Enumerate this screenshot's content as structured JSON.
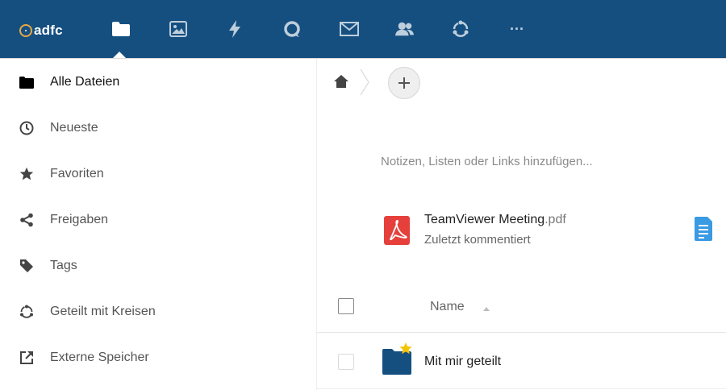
{
  "header": {
    "logo_text": "adfc",
    "bg_color": "#154f80",
    "logo_accent": "#e8a845",
    "apps": [
      {
        "name": "files",
        "icon": "folder-icon",
        "active": true
      },
      {
        "name": "photos",
        "icon": "image-icon",
        "active": false
      },
      {
        "name": "activity",
        "icon": "lightning-icon",
        "active": false
      },
      {
        "name": "talk",
        "icon": "talk-icon",
        "active": false
      },
      {
        "name": "mail",
        "icon": "mail-icon",
        "active": false
      },
      {
        "name": "contacts",
        "icon": "contacts-icon",
        "active": false
      },
      {
        "name": "circles",
        "icon": "circles-icon",
        "active": false
      },
      {
        "name": "more",
        "icon": "more-icon",
        "label": "···",
        "active": false
      }
    ]
  },
  "sidebar": {
    "items": [
      {
        "label": "Alle Dateien",
        "icon": "folder-icon",
        "active": true
      },
      {
        "label": "Neueste",
        "icon": "clock-icon"
      },
      {
        "label": "Favoriten",
        "icon": "star-icon"
      },
      {
        "label": "Freigaben",
        "icon": "share-icon"
      },
      {
        "label": "Tags",
        "icon": "tag-icon"
      },
      {
        "label": "Geteilt mit Kreisen",
        "icon": "circles-icon"
      },
      {
        "label": "Externe Speicher",
        "icon": "external-link-icon"
      }
    ]
  },
  "main": {
    "new_button_label": "+",
    "notes_placeholder": "Notizen, Listen oder Links hinzufügen...",
    "recent": {
      "file_base": "TeamViewer Meeting",
      "file_ext": ".pdf",
      "subtitle": "Zuletzt kommentiert",
      "pdf_color": "#e5403c",
      "doc_color": "#3a9ae2"
    },
    "list": {
      "column_name": "Name",
      "rows": [
        {
          "name": "Mit mir geteilt",
          "favorite": true,
          "folder_color": "#154f80",
          "star_color": "#f5c400"
        }
      ]
    }
  }
}
